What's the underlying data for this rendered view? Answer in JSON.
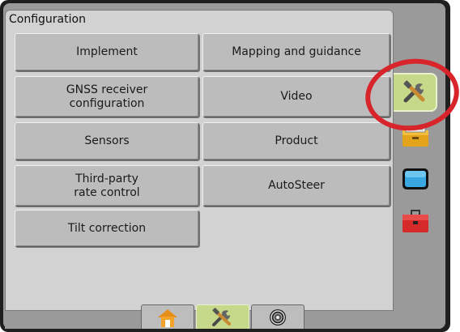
{
  "panel": {
    "title": "Configuration"
  },
  "menu": {
    "implement": "Implement",
    "mapping_guidance": "Mapping and guidance",
    "gnss": "GNSS receiver\nconfiguration",
    "video": "Video",
    "sensors": "Sensors",
    "product": "Product",
    "third_party": "Third-party\nrate control",
    "autosteer": "AutoSteer",
    "tilt": "Tilt correction"
  },
  "side_tabs": [
    {
      "icon": "tools-icon",
      "active": true
    },
    {
      "icon": "toolbox-yellow-icon",
      "active": false
    },
    {
      "icon": "screen-blue-icon",
      "active": false
    },
    {
      "icon": "toolbox-red-icon",
      "active": false
    }
  ],
  "bottom_tabs": [
    {
      "icon": "home-icon",
      "active": false
    },
    {
      "icon": "tools-icon",
      "active": true
    },
    {
      "icon": "camera-icon",
      "active": false
    }
  ],
  "colors": {
    "active_tab": "#c6d98a",
    "highlight": "#d7252b",
    "panel": "#d2d2d2",
    "button": "#bcbcbc"
  }
}
